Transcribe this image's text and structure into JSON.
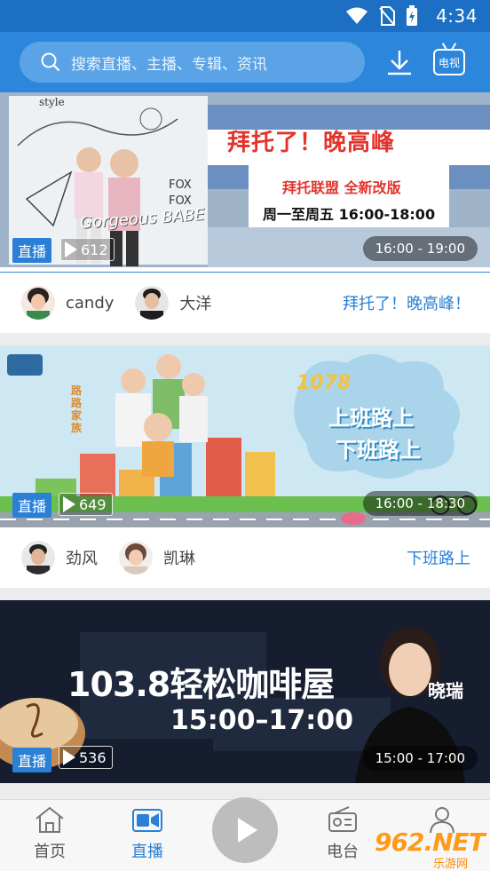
{
  "status_bar": {
    "time": "4:34"
  },
  "header": {
    "search_placeholder": "搜索直播、主播、专辑、资讯",
    "tv_label": "电视"
  },
  "cards": [
    {
      "banner": {
        "title": "拜托了！晚高峰",
        "subtitle": "拜托联盟 全新改版",
        "schedule": "周一至周五 16:00-18:00",
        "decor_text_1": "style",
        "decor_text_2": "FOX FOX",
        "decor_text_3": "Gorgeous BABE"
      },
      "live_label": "直播",
      "play_count": "612",
      "time_range": "16:00 - 19:00",
      "hosts": [
        "candy",
        "大洋"
      ],
      "program": "拜托了！晚高峰！"
    },
    {
      "banner": {
        "freq": "1078",
        "title_1": "上班路上",
        "title_2": "下班路上",
        "side_text": "路路家族"
      },
      "live_label": "直播",
      "play_count": "649",
      "time_range": "16:00 - 18:30",
      "hosts": [
        "劲风",
        "凯琳"
      ],
      "program": "下班路上"
    },
    {
      "banner": {
        "title": "103.8轻松咖啡屋",
        "schedule": "15:00–17:00",
        "host_tag": "晓瑞"
      },
      "live_label": "直播",
      "play_count": "536",
      "time_range": "15:00 - 17:00"
    }
  ],
  "bottom_nav": {
    "items": [
      {
        "label": "首页",
        "icon": "home-icon"
      },
      {
        "label": "直播",
        "icon": "video-icon"
      },
      {
        "label": "电台",
        "icon": "radio-icon"
      },
      {
        "label": "我的",
        "icon": "user-icon"
      }
    ]
  },
  "watermark": {
    "main": "962.NET",
    "sub": "乐游网"
  },
  "colors": {
    "primary": "#2b86dc",
    "status": "#1c6fc2",
    "accent": "#2a7fd6"
  }
}
